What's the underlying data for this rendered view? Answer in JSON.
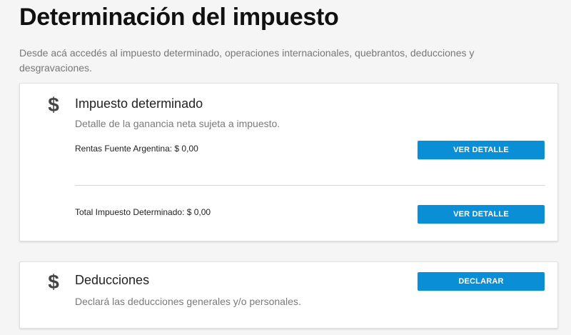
{
  "page": {
    "title": "Determinación del impuesto",
    "description": "Desde acá accedés al impuesto determinado, operaciones internacionales, quebrantos, deducciones y desgravaciones."
  },
  "cards": [
    {
      "icon": "dollar-icon",
      "title": "Impuesto determinado",
      "subtitle": "Detalle de la ganancia neta sujeta a impuesto.",
      "rows": [
        {
          "text": "Rentas Fuente Argentina: $ 0,00",
          "button_label": "VER DETALLE"
        },
        {
          "text": "Total Impuesto Determinado: $ 0,00",
          "button_label": "VER DETALLE"
        }
      ]
    },
    {
      "icon": "dollar-icon",
      "title": "Deducciones",
      "subtitle": "Declará las deducciones generales y/o personales.",
      "button_label": "DECLARAR"
    }
  ],
  "colors": {
    "accent": "#0a8fd6",
    "background": "#f5f5f5",
    "card": "#ffffff"
  }
}
